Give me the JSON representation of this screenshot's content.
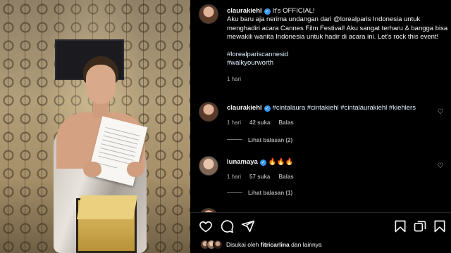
{
  "post": {
    "author": "claurakiehl",
    "caption_lead": "It's OFFICIAL!",
    "caption_body": "Aku baru aja nerima undangan dari @lorealparis Indonesia untuk menghadiri acara Cannes Film Festival! Aku sangat terharu & bangga bisa mewakili wanita Indonesia untuk hadir di acara ini. Let's rock this event!",
    "hashtag_1": "#lorealpariscannesid",
    "hashtag_2": "#walkyourworth",
    "time": "1 hari"
  },
  "comments": [
    {
      "author": "claurakiehl",
      "text": "#cintalaura #cintakiehl #cintalaurakiehl #kiehlers",
      "time": "1 hari",
      "likes": "42 suka",
      "reply": "Balas",
      "view_replies": "Lihat balasan (2)"
    },
    {
      "author": "lunamaya",
      "text": "🔥🔥🔥",
      "time": "1 hari",
      "likes": "57 suka",
      "reply": "Balas",
      "view_replies": "Lihat balasan (1)"
    }
  ],
  "liked_by": {
    "prefix": "Disukai oleh",
    "user": "fitricarlina",
    "suffix": "dan lainnya"
  },
  "icons": {
    "like": "heart-icon",
    "comment": "comment-icon",
    "share": "send-icon",
    "save": "bookmark-icon",
    "verified": "verified-badge-icon"
  },
  "colors": {
    "background": "#000000",
    "verified": "#3897f0",
    "muted": "#a8a8a8"
  }
}
